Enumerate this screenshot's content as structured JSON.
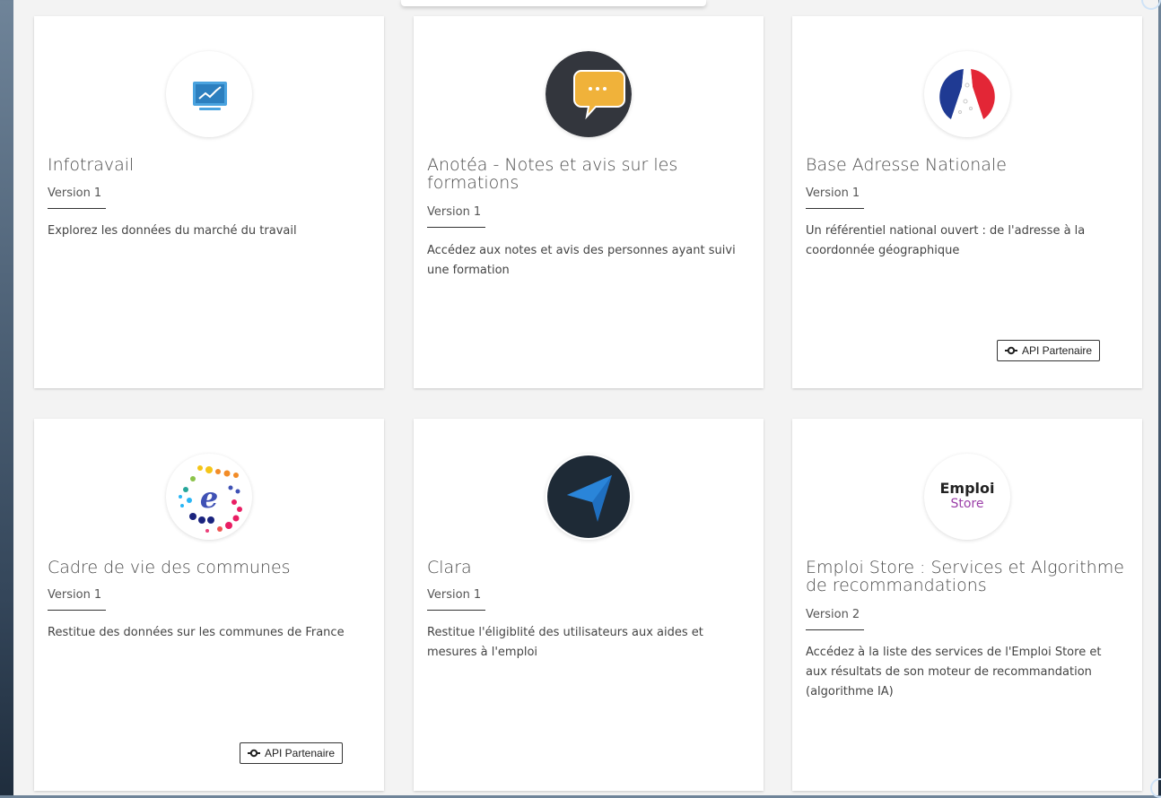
{
  "badge_label": "API Partenaire",
  "badge_icon": "commit-icon",
  "cards": [
    {
      "title": "Infotravail",
      "version": "Version 1",
      "description": "Explorez les données du marché du travail",
      "icon": "monitor-chart-icon"
    },
    {
      "title": "Anotéa - Notes et avis sur les formations",
      "version": "Version 1",
      "description": "Accédez aux notes et avis des personnes ayant suivi une formation",
      "icon": "speech-bubble-icon"
    },
    {
      "title": "Base Adresse Nationale",
      "version": "Version 1",
      "description": "Un référentiel national ouvert : de l'adresse à la coordonnée géographique",
      "icon": "french-flag-pin-icon",
      "partner": true
    },
    {
      "title": "Cadre de vie des communes",
      "version": "Version 1",
      "description": "Restitue des données sur les communes de France",
      "icon": "colorful-dots-e-icon",
      "partner": true
    },
    {
      "title": "Clara",
      "version": "Version 1",
      "description": "Restitue l'éligiblité des utilisateurs aux aides et mesures à l'emploi",
      "icon": "navigation-arrow-icon"
    },
    {
      "title": "Emploi Store : Services et Algorithme de recommandations",
      "version": "Version 2",
      "description": "Accédez à la liste des services de l'Emploi Store et aux résultats de son moteur de recommandation (algorithme IA)",
      "icon": "emploi-store-logo",
      "logo_text_top": "Emploi",
      "logo_text_bottom": "Store"
    }
  ],
  "colors": {
    "card_bg": "#ffffff",
    "page_bg": "#f3f3f3",
    "flag_blue": "#1f3a93",
    "flag_red": "#e32636",
    "anotea_dark": "#33363d",
    "anotea_bubble": "#f0b23a",
    "clara_dark": "#1e2a36",
    "clara_arrow": "#1f6fc0",
    "emploi_store_purple": "#9b3fa8"
  }
}
